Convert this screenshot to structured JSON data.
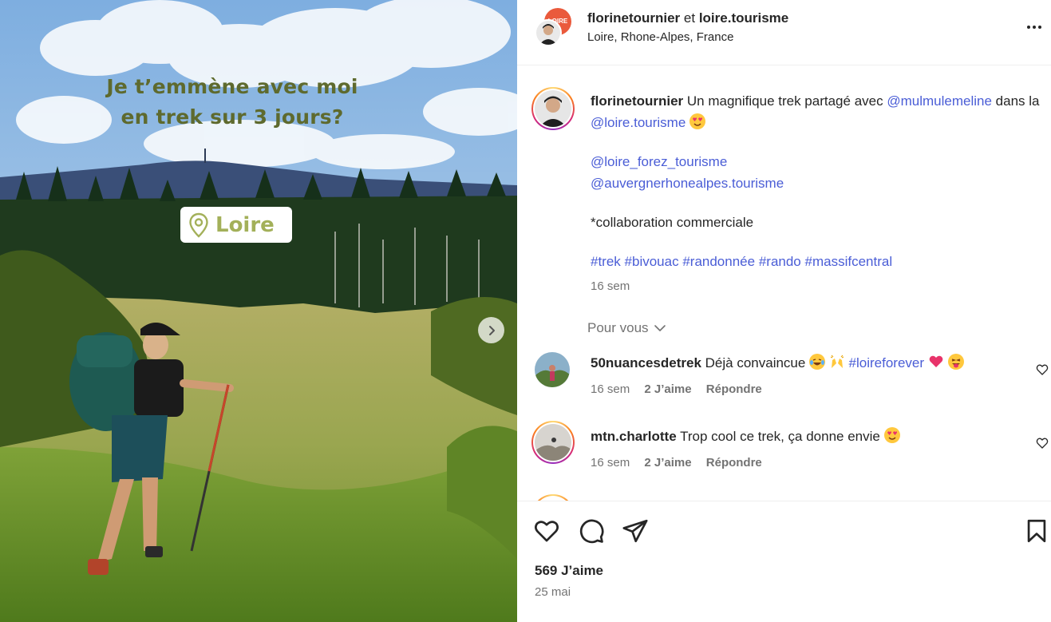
{
  "post_image": {
    "title_line1": "Je t’emmène avec moi",
    "title_line2": "en trek sur 3 jours?",
    "location_badge": "Loire"
  },
  "header": {
    "author": "florinetournier",
    "joiner": "et",
    "collaborator": "loire.tourisme",
    "collab_logo_text": "LOIRE",
    "location": "Loire, Rhone-Alpes, France"
  },
  "caption": {
    "author": "florinetournier",
    "text_1": "Un magnifique trek partagé avec",
    "mention_1": "@mulmulemeline",
    "text_2": "dans la",
    "mention_2": "@loire.tourisme",
    "mention_3": "@loire_forez_tourisme",
    "mention_4": "@auvergnerhonealpes.tourisme",
    "disclaimer": "*collaboration commerciale",
    "hashtags": [
      "#trek",
      "#bivouac",
      "#randonnée",
      "#rando",
      "#massifcentral"
    ],
    "age": "16 sem"
  },
  "for_you_label": "Pour vous",
  "comments": [
    {
      "user": "50nuancesdetrek",
      "text": "Déjà convaincue",
      "hashtag": "#loireforever",
      "age": "16 sem",
      "likes": "2 J’aime",
      "reply": "Répondre"
    },
    {
      "user": "mtn.charlotte",
      "text": "Trop cool ce trek, ça donne envie",
      "age": "16 sem",
      "likes": "2 J’aime",
      "reply": "Répondre"
    }
  ],
  "footer": {
    "likes": "569 J’aime",
    "date": "25 mai"
  },
  "colors": {
    "link": "#4a5dd6",
    "title_green": "#5e6a2e",
    "badge_green": "#a3b059",
    "muted": "#737373"
  },
  "icons": [
    "more-icon",
    "chevron-right-icon",
    "chevron-down-icon",
    "heart-icon",
    "comment-icon",
    "share-icon",
    "bookmark-icon",
    "map-pin-icon"
  ]
}
